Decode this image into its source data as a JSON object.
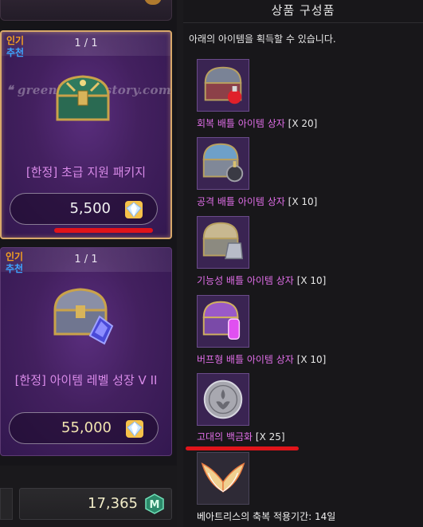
{
  "shop": {
    "cards": [
      {
        "badge_hot": "인기",
        "badge_rec": "추천",
        "count": "1 / 1",
        "name": "[한정] 초급 지원 패키지",
        "price": "5,500",
        "watermark": "❝ greenlight.tistory.com"
      },
      {
        "badge_hot": "인기",
        "badge_rec": "추천",
        "count": "1 / 1",
        "name": "[한정] 아이템 레벨 성장 V II",
        "price": "55,000"
      }
    ],
    "balance": "17,365",
    "balance_icon_letter": "M"
  },
  "composition": {
    "title": "상품 구성품",
    "description": "아래의 아이템을 획득할 수 있습니다.",
    "items": [
      {
        "name": "회복 배틀 아이템 상자",
        "qty": "[X 20]",
        "icon": "heal-battle-chest-icon"
      },
      {
        "name": "공격 배틀 아이템 상자",
        "qty": "[X 10]",
        "icon": "attack-battle-chest-icon"
      },
      {
        "name": "기능성 배틀 아이템 상자",
        "qty": "[X 10]",
        "icon": "utility-battle-chest-icon"
      },
      {
        "name": "버프형 배틀 아이템 상자",
        "qty": "[X 10]",
        "icon": "buff-battle-chest-icon"
      },
      {
        "name": "고대의 백금화",
        "qty": "[X 25]",
        "icon": "ancient-platinum-coin-icon"
      },
      {
        "name": "베아트리스의 축복 적용기간: 14일",
        "icon": "beatrice-blessing-wings-icon"
      }
    ]
  },
  "colors": {
    "item_name": "#e06ee8",
    "card_name": "#d88ae8",
    "badge_hot": "#f4a020",
    "badge_rec": "#3ea4ff",
    "highlight_underline": "#e0141a"
  }
}
